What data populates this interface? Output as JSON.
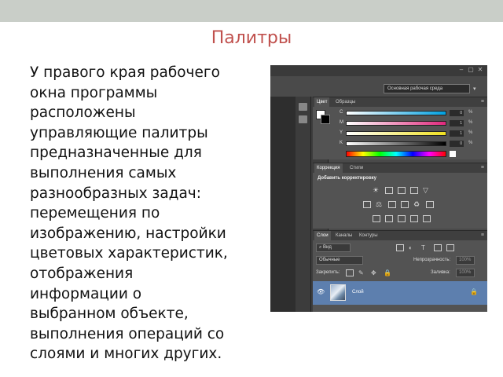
{
  "slide": {
    "title": "Палитры",
    "body": "У правого края рабочего\nокна программы\nрасположены\nуправляющие палитры\nпредназначенные для\nвыполнения самых\nразнообразных задач:\nперемещения по\nизображению, настройки\nцветовых характеристик,\nотображения\nинформации о\nвыбранном объекте,\nвыполнения операций со\nслоями и многих других."
  },
  "screenshot": {
    "window_buttons": [
      "‒",
      "▢",
      "✕"
    ],
    "workspace": "Основная рабочая среда",
    "color_panel": {
      "tabs": [
        "Цвет",
        "Образцы"
      ],
      "sliders": [
        {
          "label": "C",
          "value": "0",
          "colors": "#ffffff,#00a0e0"
        },
        {
          "label": "M",
          "value": "1",
          "colors": "#ffffff,#e0287c"
        },
        {
          "label": "Y",
          "value": "1",
          "colors": "#ffffff,#f0e020"
        },
        {
          "label": "K",
          "value": "0",
          "colors": "#ffffff,#000000"
        }
      ],
      "percent": "%"
    },
    "adjust_panel": {
      "tabs": [
        "Коррекция",
        "Стили"
      ],
      "heading": "Добавить корректировку"
    },
    "layers_panel": {
      "tabs": [
        "Слои",
        "Каналы",
        "Контуры"
      ],
      "kind": "Вид",
      "blend_mode": "Обычные",
      "opacity_label": "Непрозрачность:",
      "opacity_value": "100%",
      "lock_label": "Закрепить:",
      "fill_label": "Заливка:",
      "fill_value": "100%",
      "layer_name": "Слой"
    },
    "colors": {
      "accent_title": "#c0504d",
      "layer_selected": "#5d7fae"
    }
  }
}
